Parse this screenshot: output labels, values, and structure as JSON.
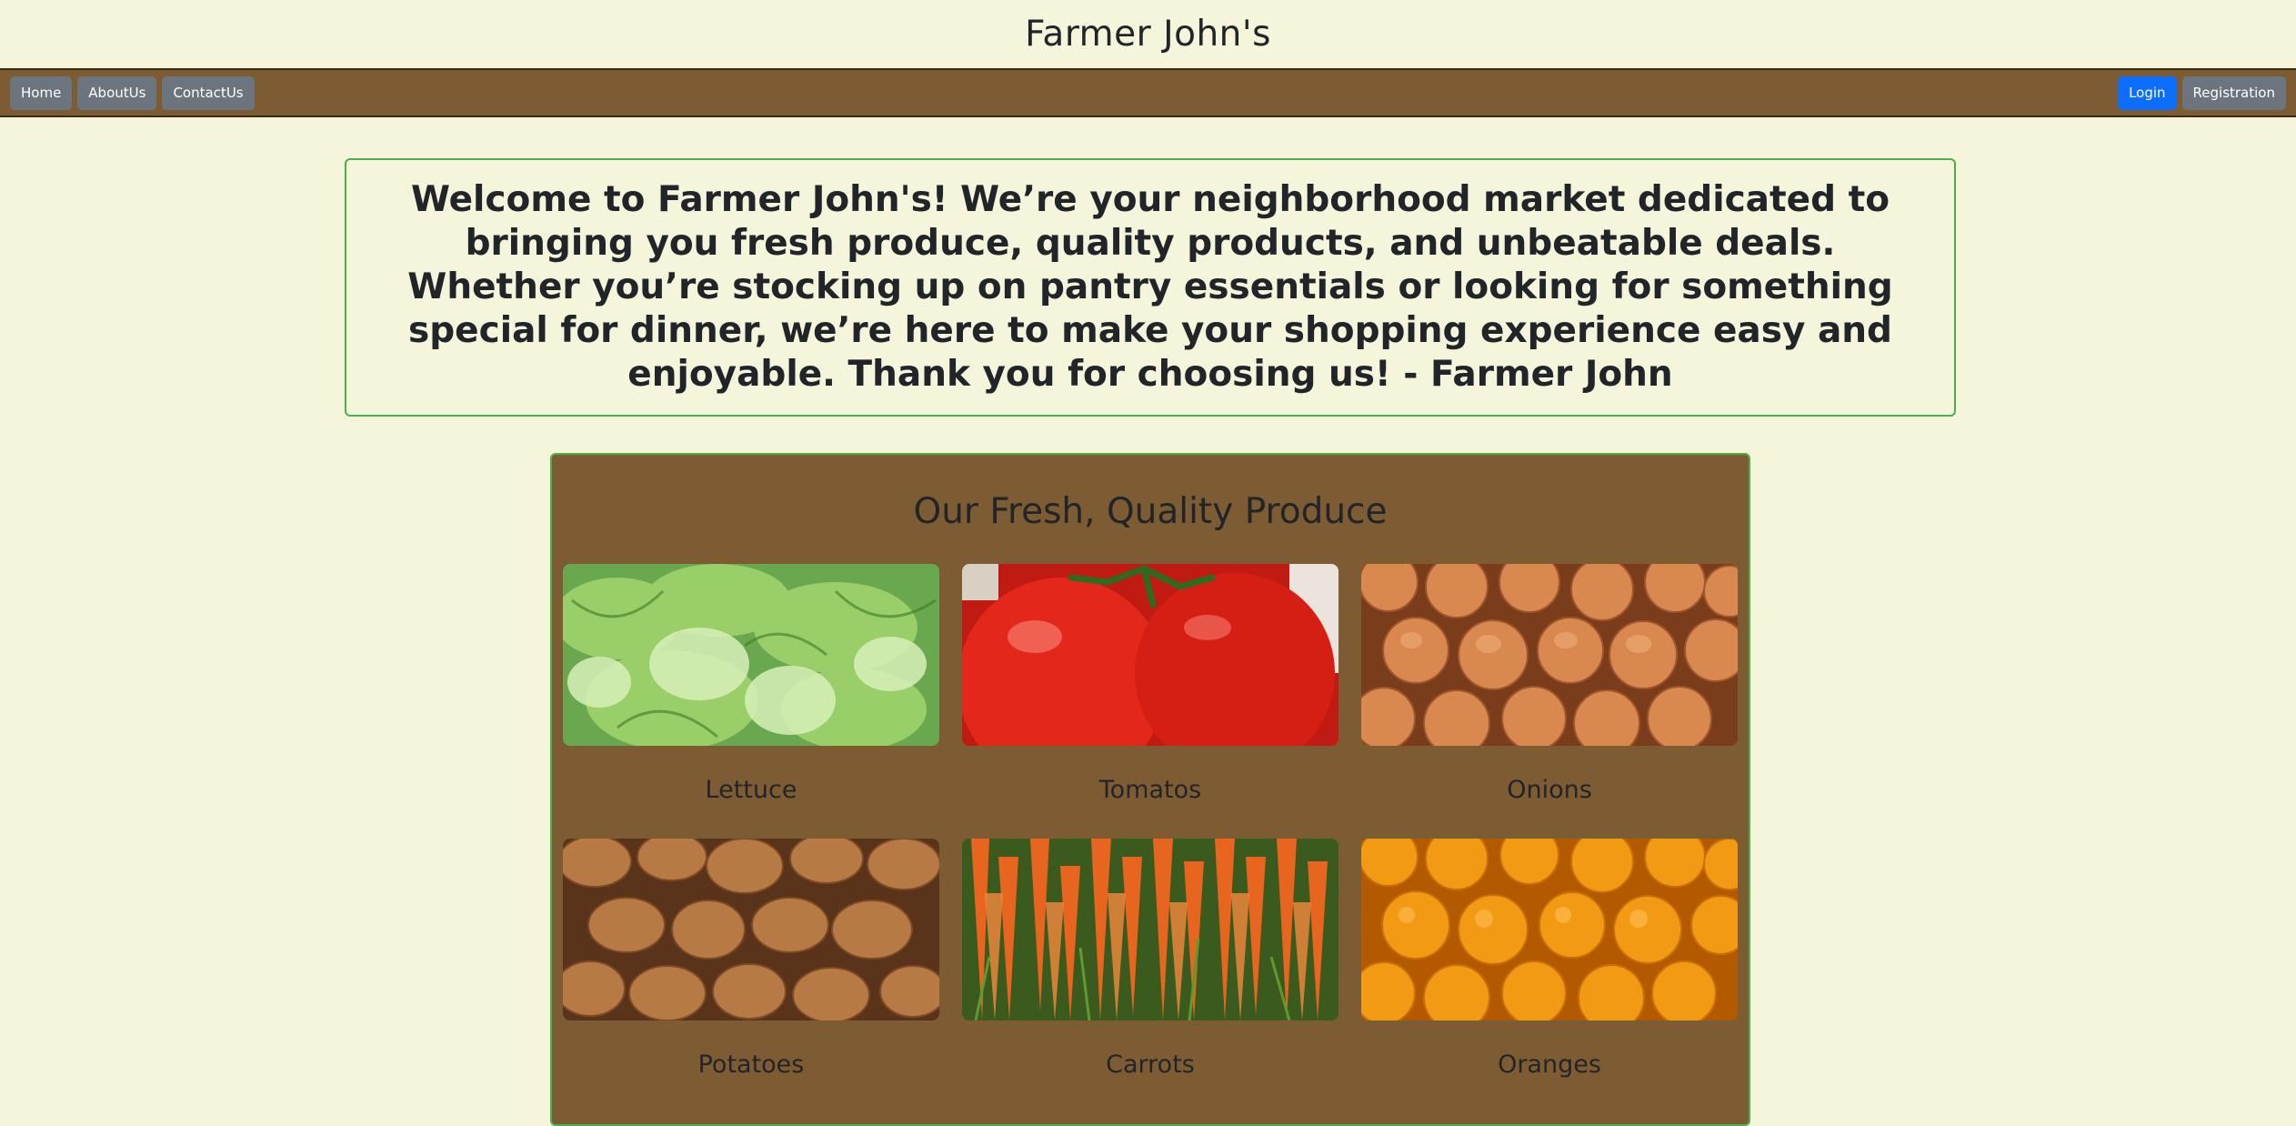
{
  "header": {
    "title": "Farmer John's"
  },
  "nav": {
    "left": [
      {
        "label": "Home"
      },
      {
        "label": "AboutUs"
      },
      {
        "label": "ContactUs"
      }
    ],
    "right": [
      {
        "label": "Login"
      },
      {
        "label": "Registration"
      }
    ]
  },
  "welcome": {
    "text": "Welcome to Farmer John's! We’re your neighborhood market dedicated to bringing you fresh produce, quality products, and unbeatable deals. Whether you’re stocking up on pantry essentials or looking for something special for dinner, we’re here to make your shopping experience easy and enjoyable. Thank you for choosing us! - Farmer John"
  },
  "produce": {
    "heading": "Our Fresh, Quality Produce",
    "items": [
      {
        "name": "Lettuce"
      },
      {
        "name": "Tomatos"
      },
      {
        "name": "Onions"
      },
      {
        "name": "Potatoes"
      },
      {
        "name": "Carrots"
      },
      {
        "name": "Oranges"
      }
    ]
  },
  "colors": {
    "page_bg": "#f5f5dc",
    "nav_bg": "#7e5c33",
    "panel_border": "#4caf50",
    "primary_button": "#0d6efd",
    "secondary_button": "#6c757d"
  }
}
